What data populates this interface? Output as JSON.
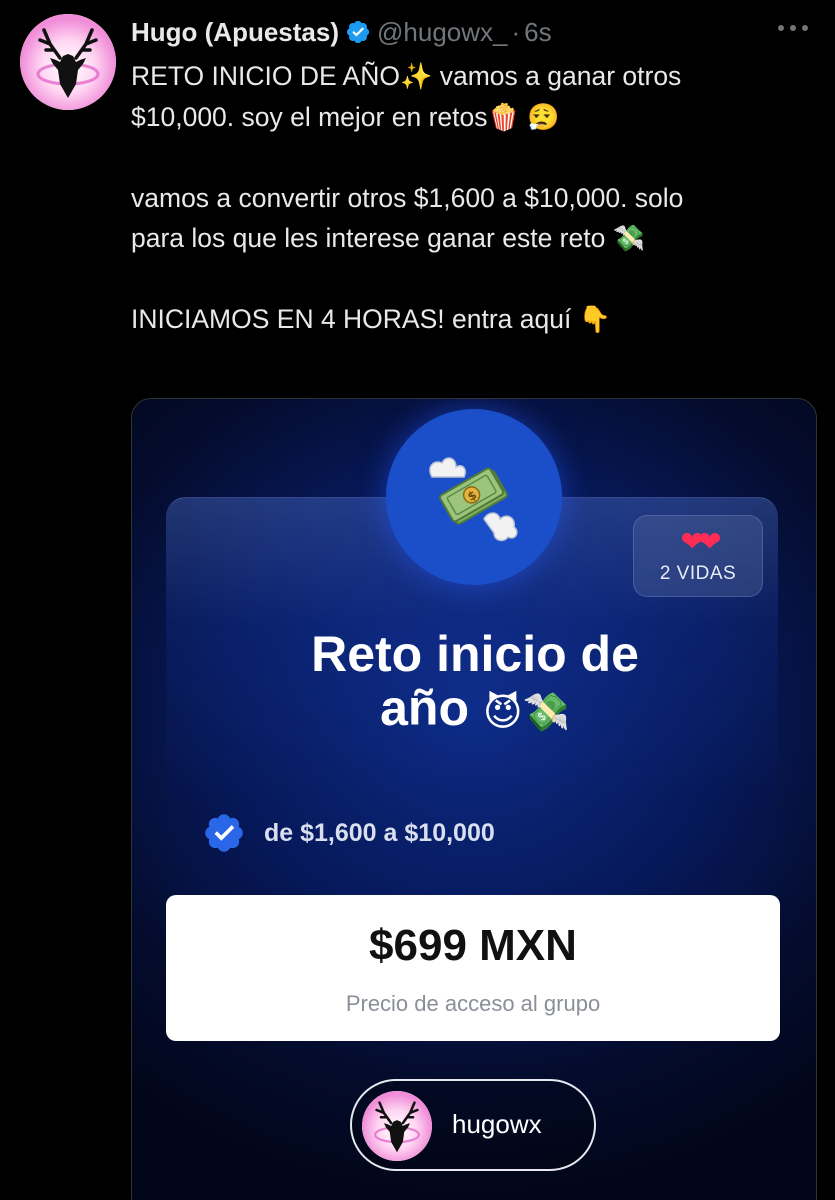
{
  "tweet": {
    "display_name": "Hugo (Apuestas)",
    "handle": "@hugowx_",
    "separator": "·",
    "timestamp": "6s",
    "lines": [
      "RETO INICIO DE AÑO",
      "vamos a ganar otros",
      "$10,000. soy el mejor en retos",
      "vamos a convertir otros $1,600 a $10,000. solo",
      "para los que les interese ganar este reto",
      "INICIAMOS EN 4 HORAS! entra aquí"
    ],
    "emoji": {
      "sparkles": "✨",
      "popcorn": "🍿",
      "face": "😮‍💨",
      "money_wings": "💸",
      "point_down": "👇"
    }
  },
  "icons": {
    "verified": "verified-badge-icon",
    "more": "more-options-icon",
    "avatar": "deer-logo-icon"
  },
  "card": {
    "lives_hearts": "❤❤",
    "lives_label": "2 VIDAS",
    "title_line1": "Reto inicio de",
    "title_line2": "año",
    "title_emoji": "😈💸",
    "range_text": "de $1,600 a $10,000",
    "price": "$699 MXN",
    "price_caption": "Precio de acceso al grupo",
    "profile_name": "hugowx"
  },
  "colors": {
    "background": "#000000",
    "text": "#e7e9ea",
    "muted": "#71767b",
    "verified": "#1d9bf0",
    "card_circle": "#1a4fc9",
    "hearts": "#ff2d55"
  }
}
